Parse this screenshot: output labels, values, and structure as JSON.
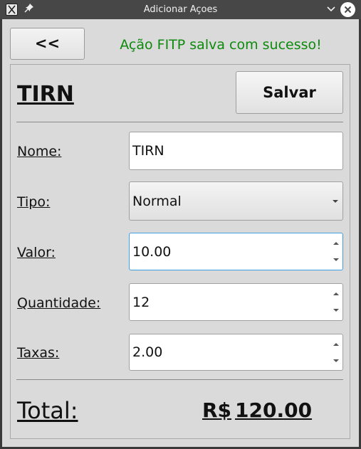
{
  "titlebar": {
    "title": "Adicionar Açoes",
    "app_icon": "app-icon",
    "pin_icon": "pin-icon",
    "minimize_icon": "chevron-down-icon",
    "close_icon": "close-icon"
  },
  "header": {
    "back_label": "<<",
    "status_message": "Ação FITP salva com sucesso!",
    "status_color": "#0c8a0c"
  },
  "form": {
    "ticker": "TIRN",
    "save_label": "Salvar",
    "fields": {
      "nome": {
        "label": "Nome:",
        "value": "TIRN"
      },
      "tipo": {
        "label": "Tipo:",
        "value": "Normal"
      },
      "valor": {
        "label": "Valor:",
        "value": "10.00"
      },
      "quantidade": {
        "label": "Quantidade:",
        "value": "12"
      },
      "taxas": {
        "label": "Taxas:",
        "value": "2.00"
      }
    },
    "total": {
      "label": "Total:",
      "currency": "R$",
      "value": "120.00"
    }
  },
  "colors": {
    "accent_focus": "#3d9fe0",
    "window_bg": "#dadada",
    "titlebar_bg": "#474747"
  }
}
